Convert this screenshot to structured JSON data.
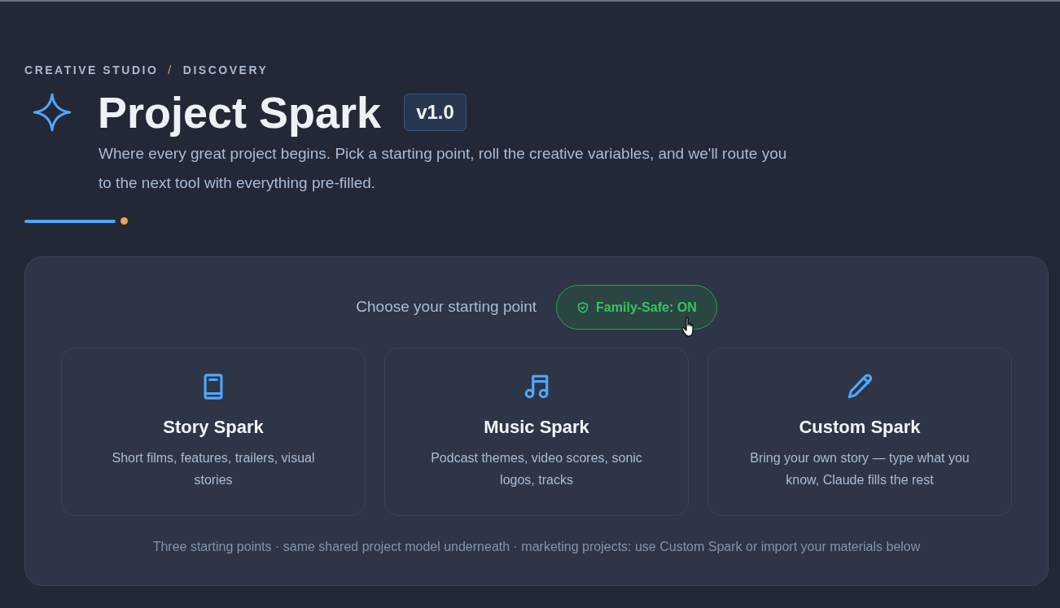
{
  "breadcrumb": [
    "CREATIVE STUDIO",
    "/",
    "DISCOVERY"
  ],
  "title": "Project Spark",
  "version": "v1.0",
  "description": "Where every great project begins. Pick a starting point, roll the creative variables, and we'll route you to the next tool with everything pre-filled.",
  "picker": {
    "heading": "Choose your starting point",
    "family_safe": {
      "label": "Family-Safe: ON",
      "on": true
    },
    "cards": [
      {
        "kind": "book",
        "title": "Story Spark",
        "description": "Short films, features, trailers, visual stories"
      },
      {
        "kind": "music",
        "title": "Music Spark",
        "description": "Podcast themes, video scores, sonic logos, tracks"
      },
      {
        "kind": "pencil",
        "title": "Custom Spark",
        "description": "Bring your own story — type what you know, Claude fills the rest"
      }
    ],
    "footnote": "Three starting points · same shared project model underneath · marketing projects: use Custom Spark or import your materials below"
  }
}
